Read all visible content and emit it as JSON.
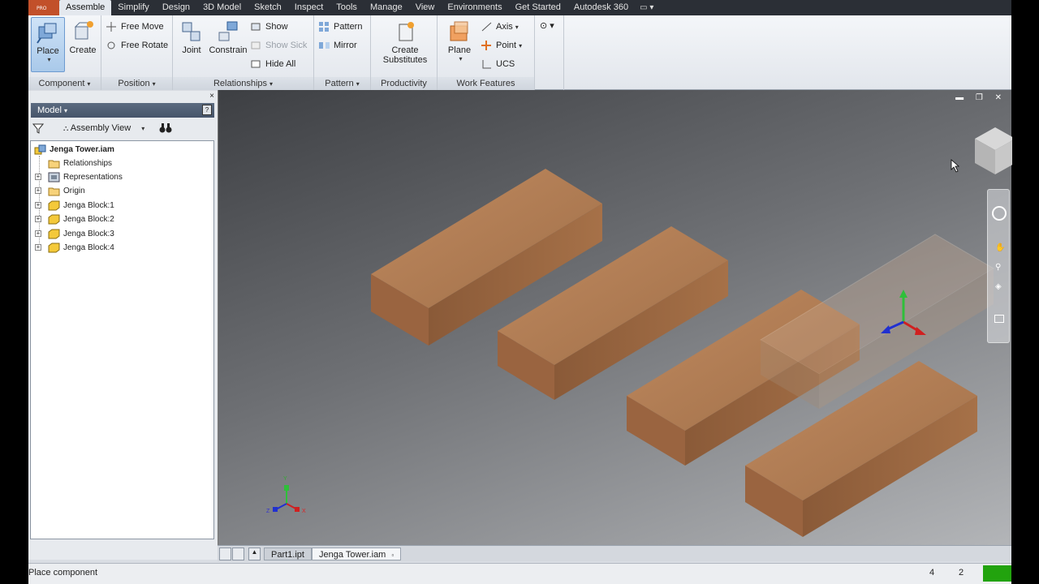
{
  "tabs": [
    "Assemble",
    "Simplify",
    "Design",
    "3D Model",
    "Sketch",
    "Inspect",
    "Tools",
    "Manage",
    "View",
    "Environments",
    "Get Started",
    "Autodesk 360"
  ],
  "app_button_text": "PRO",
  "ribbon": {
    "component": {
      "title": "Component",
      "place": "Place",
      "create": "Create"
    },
    "position": {
      "title": "Position",
      "free_move": "Free Move",
      "free_rotate": "Free Rotate"
    },
    "relationships": {
      "title": "Relationships",
      "joint": "Joint",
      "constrain": "Constrain",
      "show": "Show",
      "show_sick": "Show Sick",
      "hide_all": "Hide All"
    },
    "pattern": {
      "title": "Pattern",
      "pattern": "Pattern",
      "mirror": "Mirror"
    },
    "productivity": {
      "title": "Productivity",
      "create_substitutes_1": "Create",
      "create_substitutes_2": "Substitutes"
    },
    "work_features": {
      "title": "Work Features",
      "plane": "Plane",
      "axis": "Axis",
      "point": "Point",
      "ucs": "UCS"
    }
  },
  "browser": {
    "title": "Model",
    "view_mode": "Assembly View",
    "root": "Jenga Tower.iam",
    "nodes": [
      {
        "label": "Relationships"
      },
      {
        "label": "Representations"
      },
      {
        "label": "Origin"
      },
      {
        "label": "Jenga Block:1"
      },
      {
        "label": "Jenga Block:2"
      },
      {
        "label": "Jenga Block:3"
      },
      {
        "label": "Jenga Block:4"
      }
    ]
  },
  "viewport": {
    "triad_x": "X",
    "triad_y": "Y",
    "triad_z": "Z"
  },
  "doc_tabs": [
    "Part1.ipt",
    "Jenga Tower.iam"
  ],
  "status": {
    "message": "Place component",
    "count_a": "4",
    "count_b": "2"
  },
  "colors": {
    "wood_top": "#b07a52",
    "wood_side": "#8e5f3c",
    "accent_green": "#22a30e"
  }
}
